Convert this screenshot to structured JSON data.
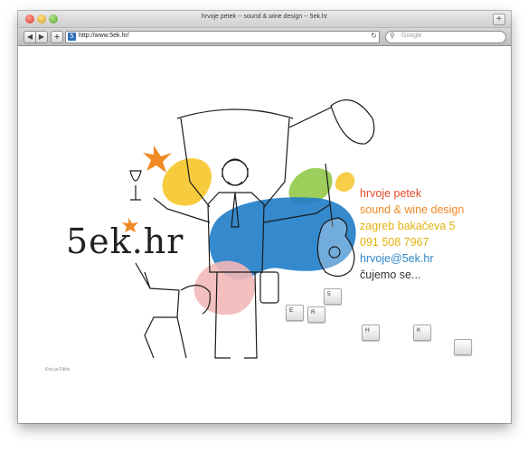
{
  "window": {
    "title": "hrvoje petek -- sound & wine design -- 5ek.hr",
    "toolbar": {
      "back_label": "◀",
      "forward_label": "▶",
      "add_label": "+",
      "url": "http://www.5ek.hr/",
      "reload_icon": "↻",
      "search_placeholder": "Google"
    },
    "corner_button": "+"
  },
  "page": {
    "logo": "5ek.hr",
    "info_lines": [
      {
        "text": "hrvoje petek",
        "color": "#e14a2b"
      },
      {
        "text": "sound & wine design",
        "color": "#f08a24"
      },
      {
        "text": "zagreb bakačeva 5",
        "color": "#e3b20d"
      },
      {
        "text": "091 508 7967",
        "color": "#e3b20d"
      },
      {
        "text": "hrvoje@5ek.hr",
        "color": "#2f86c8"
      },
      {
        "text": "čujemo se...",
        "color": "#333333"
      }
    ],
    "keys": [
      "5",
      "E",
      "R",
      "H",
      "K",
      ""
    ],
    "credit": "Kiru ja Fiktiv"
  },
  "colors": {
    "blob_blue": "#1f7cc8",
    "blob_yellow": "#f4c21b",
    "blob_green": "#8cc63f",
    "blob_pink": "#f2b8b8",
    "star_orange": "#f08a24"
  }
}
